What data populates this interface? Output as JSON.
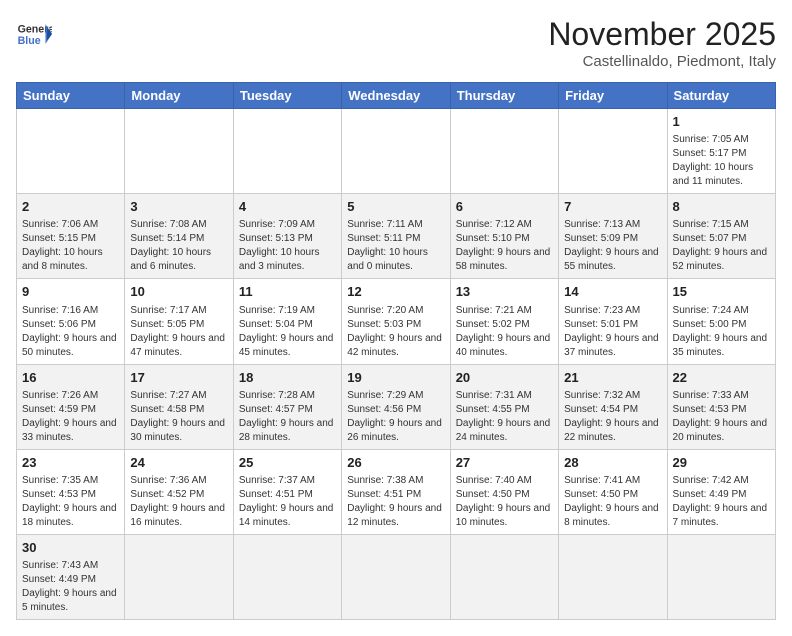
{
  "header": {
    "logo_general": "General",
    "logo_blue": "Blue",
    "month_title": "November 2025",
    "location": "Castellinaldo, Piedmont, Italy"
  },
  "weekdays": [
    "Sunday",
    "Monday",
    "Tuesday",
    "Wednesday",
    "Thursday",
    "Friday",
    "Saturday"
  ],
  "weeks": [
    [
      {
        "day": "",
        "info": ""
      },
      {
        "day": "",
        "info": ""
      },
      {
        "day": "",
        "info": ""
      },
      {
        "day": "",
        "info": ""
      },
      {
        "day": "",
        "info": ""
      },
      {
        "day": "",
        "info": ""
      },
      {
        "day": "1",
        "info": "Sunrise: 7:05 AM\nSunset: 5:17 PM\nDaylight: 10 hours and 11 minutes."
      }
    ],
    [
      {
        "day": "2",
        "info": "Sunrise: 7:06 AM\nSunset: 5:15 PM\nDaylight: 10 hours and 8 minutes."
      },
      {
        "day": "3",
        "info": "Sunrise: 7:08 AM\nSunset: 5:14 PM\nDaylight: 10 hours and 6 minutes."
      },
      {
        "day": "4",
        "info": "Sunrise: 7:09 AM\nSunset: 5:13 PM\nDaylight: 10 hours and 3 minutes."
      },
      {
        "day": "5",
        "info": "Sunrise: 7:11 AM\nSunset: 5:11 PM\nDaylight: 10 hours and 0 minutes."
      },
      {
        "day": "6",
        "info": "Sunrise: 7:12 AM\nSunset: 5:10 PM\nDaylight: 9 hours and 58 minutes."
      },
      {
        "day": "7",
        "info": "Sunrise: 7:13 AM\nSunset: 5:09 PM\nDaylight: 9 hours and 55 minutes."
      },
      {
        "day": "8",
        "info": "Sunrise: 7:15 AM\nSunset: 5:07 PM\nDaylight: 9 hours and 52 minutes."
      }
    ],
    [
      {
        "day": "9",
        "info": "Sunrise: 7:16 AM\nSunset: 5:06 PM\nDaylight: 9 hours and 50 minutes."
      },
      {
        "day": "10",
        "info": "Sunrise: 7:17 AM\nSunset: 5:05 PM\nDaylight: 9 hours and 47 minutes."
      },
      {
        "day": "11",
        "info": "Sunrise: 7:19 AM\nSunset: 5:04 PM\nDaylight: 9 hours and 45 minutes."
      },
      {
        "day": "12",
        "info": "Sunrise: 7:20 AM\nSunset: 5:03 PM\nDaylight: 9 hours and 42 minutes."
      },
      {
        "day": "13",
        "info": "Sunrise: 7:21 AM\nSunset: 5:02 PM\nDaylight: 9 hours and 40 minutes."
      },
      {
        "day": "14",
        "info": "Sunrise: 7:23 AM\nSunset: 5:01 PM\nDaylight: 9 hours and 37 minutes."
      },
      {
        "day": "15",
        "info": "Sunrise: 7:24 AM\nSunset: 5:00 PM\nDaylight: 9 hours and 35 minutes."
      }
    ],
    [
      {
        "day": "16",
        "info": "Sunrise: 7:26 AM\nSunset: 4:59 PM\nDaylight: 9 hours and 33 minutes."
      },
      {
        "day": "17",
        "info": "Sunrise: 7:27 AM\nSunset: 4:58 PM\nDaylight: 9 hours and 30 minutes."
      },
      {
        "day": "18",
        "info": "Sunrise: 7:28 AM\nSunset: 4:57 PM\nDaylight: 9 hours and 28 minutes."
      },
      {
        "day": "19",
        "info": "Sunrise: 7:29 AM\nSunset: 4:56 PM\nDaylight: 9 hours and 26 minutes."
      },
      {
        "day": "20",
        "info": "Sunrise: 7:31 AM\nSunset: 4:55 PM\nDaylight: 9 hours and 24 minutes."
      },
      {
        "day": "21",
        "info": "Sunrise: 7:32 AM\nSunset: 4:54 PM\nDaylight: 9 hours and 22 minutes."
      },
      {
        "day": "22",
        "info": "Sunrise: 7:33 AM\nSunset: 4:53 PM\nDaylight: 9 hours and 20 minutes."
      }
    ],
    [
      {
        "day": "23",
        "info": "Sunrise: 7:35 AM\nSunset: 4:53 PM\nDaylight: 9 hours and 18 minutes."
      },
      {
        "day": "24",
        "info": "Sunrise: 7:36 AM\nSunset: 4:52 PM\nDaylight: 9 hours and 16 minutes."
      },
      {
        "day": "25",
        "info": "Sunrise: 7:37 AM\nSunset: 4:51 PM\nDaylight: 9 hours and 14 minutes."
      },
      {
        "day": "26",
        "info": "Sunrise: 7:38 AM\nSunset: 4:51 PM\nDaylight: 9 hours and 12 minutes."
      },
      {
        "day": "27",
        "info": "Sunrise: 7:40 AM\nSunset: 4:50 PM\nDaylight: 9 hours and 10 minutes."
      },
      {
        "day": "28",
        "info": "Sunrise: 7:41 AM\nSunset: 4:50 PM\nDaylight: 9 hours and 8 minutes."
      },
      {
        "day": "29",
        "info": "Sunrise: 7:42 AM\nSunset: 4:49 PM\nDaylight: 9 hours and 7 minutes."
      }
    ],
    [
      {
        "day": "30",
        "info": "Sunrise: 7:43 AM\nSunset: 4:49 PM\nDaylight: 9 hours and 5 minutes."
      },
      {
        "day": "",
        "info": ""
      },
      {
        "day": "",
        "info": ""
      },
      {
        "day": "",
        "info": ""
      },
      {
        "day": "",
        "info": ""
      },
      {
        "day": "",
        "info": ""
      },
      {
        "day": "",
        "info": ""
      }
    ]
  ],
  "row_shades": [
    "row-shade-1",
    "row-shade-2",
    "row-shade-3",
    "row-shade-4",
    "row-shade-5",
    "row-shade-6"
  ]
}
